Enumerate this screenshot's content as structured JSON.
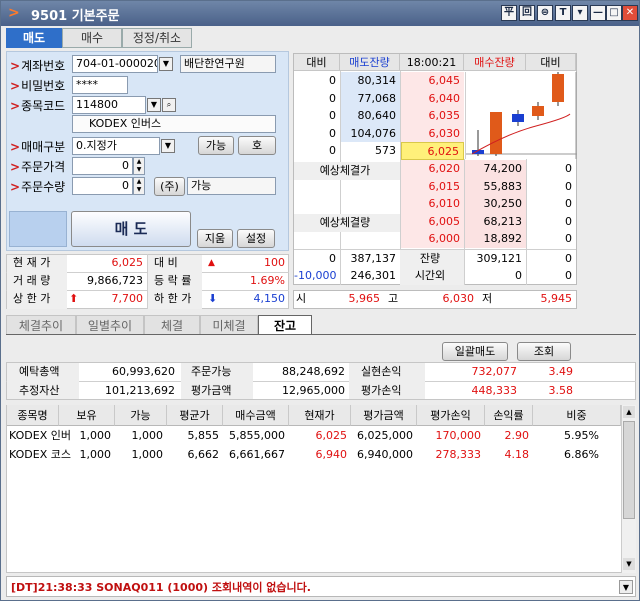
{
  "window": {
    "title": "9501 기본주문",
    "buttons": [
      "平",
      "回",
      "⊜",
      "T",
      "▾",
      "—",
      "□",
      "✕"
    ]
  },
  "order_tabs": [
    "매도",
    "매수",
    "정정/취소"
  ],
  "form": {
    "account_label": "계좌번호",
    "account_value": "704-01-000020",
    "account_name": "배단한연구원",
    "password_label": "비밀번호",
    "password_value": "****",
    "code_label": "종목코드",
    "code_value": "114800",
    "stock_name": "KODEX 인버스",
    "type_label": "매매구분",
    "type_value": "0.지정가",
    "avail_btn": "가능",
    "ho_btn": "호",
    "price_label": "주문가격",
    "price_value": "0",
    "qty_label": "주문수량",
    "qty_value": "0",
    "ju_btn": "(주)",
    "qty_avail": "가능",
    "sell_btn": "매 도",
    "clear_btn": "지움",
    "setting_btn": "설정"
  },
  "quote": {
    "headers": [
      "대비",
      "매도잔량",
      "18:00:21",
      "매수잔량",
      "대비"
    ],
    "ask_rows": [
      {
        "diff": "0",
        "qty": "80,314",
        "price": "6,045"
      },
      {
        "diff": "0",
        "qty": "77,068",
        "price": "6,040"
      },
      {
        "diff": "0",
        "qty": "80,640",
        "price": "6,035"
      },
      {
        "diff": "0",
        "qty": "104,076",
        "price": "6,030"
      },
      {
        "diff": "0",
        "qty": "573",
        "price": "6,025"
      }
    ],
    "exp_price_label": "예상체결가",
    "exp_qty_label": "예상체결량",
    "bid_rows": [
      {
        "price": "6,020",
        "qty": "74,200",
        "diff": "0"
      },
      {
        "price": "6,015",
        "qty": "55,883",
        "diff": "0"
      },
      {
        "price": "6,010",
        "qty": "30,250",
        "diff": "0"
      },
      {
        "price": "6,005",
        "qty": "68,213",
        "diff": "0"
      },
      {
        "price": "6,000",
        "qty": "18,892",
        "diff": "0"
      }
    ],
    "total_left": "0",
    "total_ask": "387,137",
    "remain_label": "잔량",
    "total_bid": "309,121",
    "total_right": "0",
    "ext_left": "-10,000",
    "ext_ask": "246,301",
    "ext_label": "시간외",
    "ext_bid": "0",
    "ext_right": "0",
    "open_label": "시",
    "open": "5,965",
    "high_label": "고",
    "high": "6,030",
    "low_label": "저",
    "low": "5,945"
  },
  "stats": {
    "cur_label": "현 재 가",
    "cur": "6,025",
    "diff_label": "대  비",
    "diff_arrow": "▲",
    "diff": "100",
    "vol_label": "거 래 량",
    "vol": "9,866,723",
    "rate_label": "등 락 률",
    "rate": "1.69%",
    "upper_label": "상 한 가",
    "upper_arrow": "⬆",
    "upper": "7,700",
    "lower_label": "하 한 가",
    "lower_arrow": "⬇",
    "lower": "4,150"
  },
  "main_tabs": [
    "체결추이",
    "일별추이",
    "체결",
    "미체결",
    "잔고"
  ],
  "actions": {
    "bulk_sell": "일괄매도",
    "query": "조회"
  },
  "summary": {
    "deposit_label": "예탁총액",
    "deposit": "60,993,620",
    "orderable_label": "주문가능",
    "orderable": "88,248,692",
    "realized_label": "실현손익",
    "realized": "732,077",
    "realized_rate": "3.49",
    "est_label": "추정자산",
    "est": "101,213,692",
    "eval_label": "평가금액",
    "eval": "12,965,000",
    "evalpl_label": "평가손익",
    "evalpl": "448,333",
    "evalpl_rate": "3.58"
  },
  "holdings": {
    "headers": [
      "종목명",
      "보유",
      "가능",
      "평균가",
      "매수금액",
      "현재가",
      "평가금액",
      "평가손익",
      "손익률",
      "비중"
    ],
    "rows": [
      [
        "KODEX 인버",
        "1,000",
        "1,000",
        "5,855",
        "5,855,000",
        "6,025",
        "6,025,000",
        "170,000",
        "2.90",
        "5.95%"
      ],
      [
        "KODEX 코스",
        "1,000",
        "1,000",
        "6,662",
        "6,661,667",
        "6,940",
        "6,940,000",
        "278,333",
        "4.18",
        "6.86%"
      ]
    ]
  },
  "status": {
    "message": "[DT]21:38:33 SONAQ011 (1000) 조회내역이 없습니다."
  },
  "colors": {
    "up": "#e01010",
    "down": "#1a3fd1",
    "title": "#4a6189",
    "active_tab": "#2f6fc9"
  }
}
